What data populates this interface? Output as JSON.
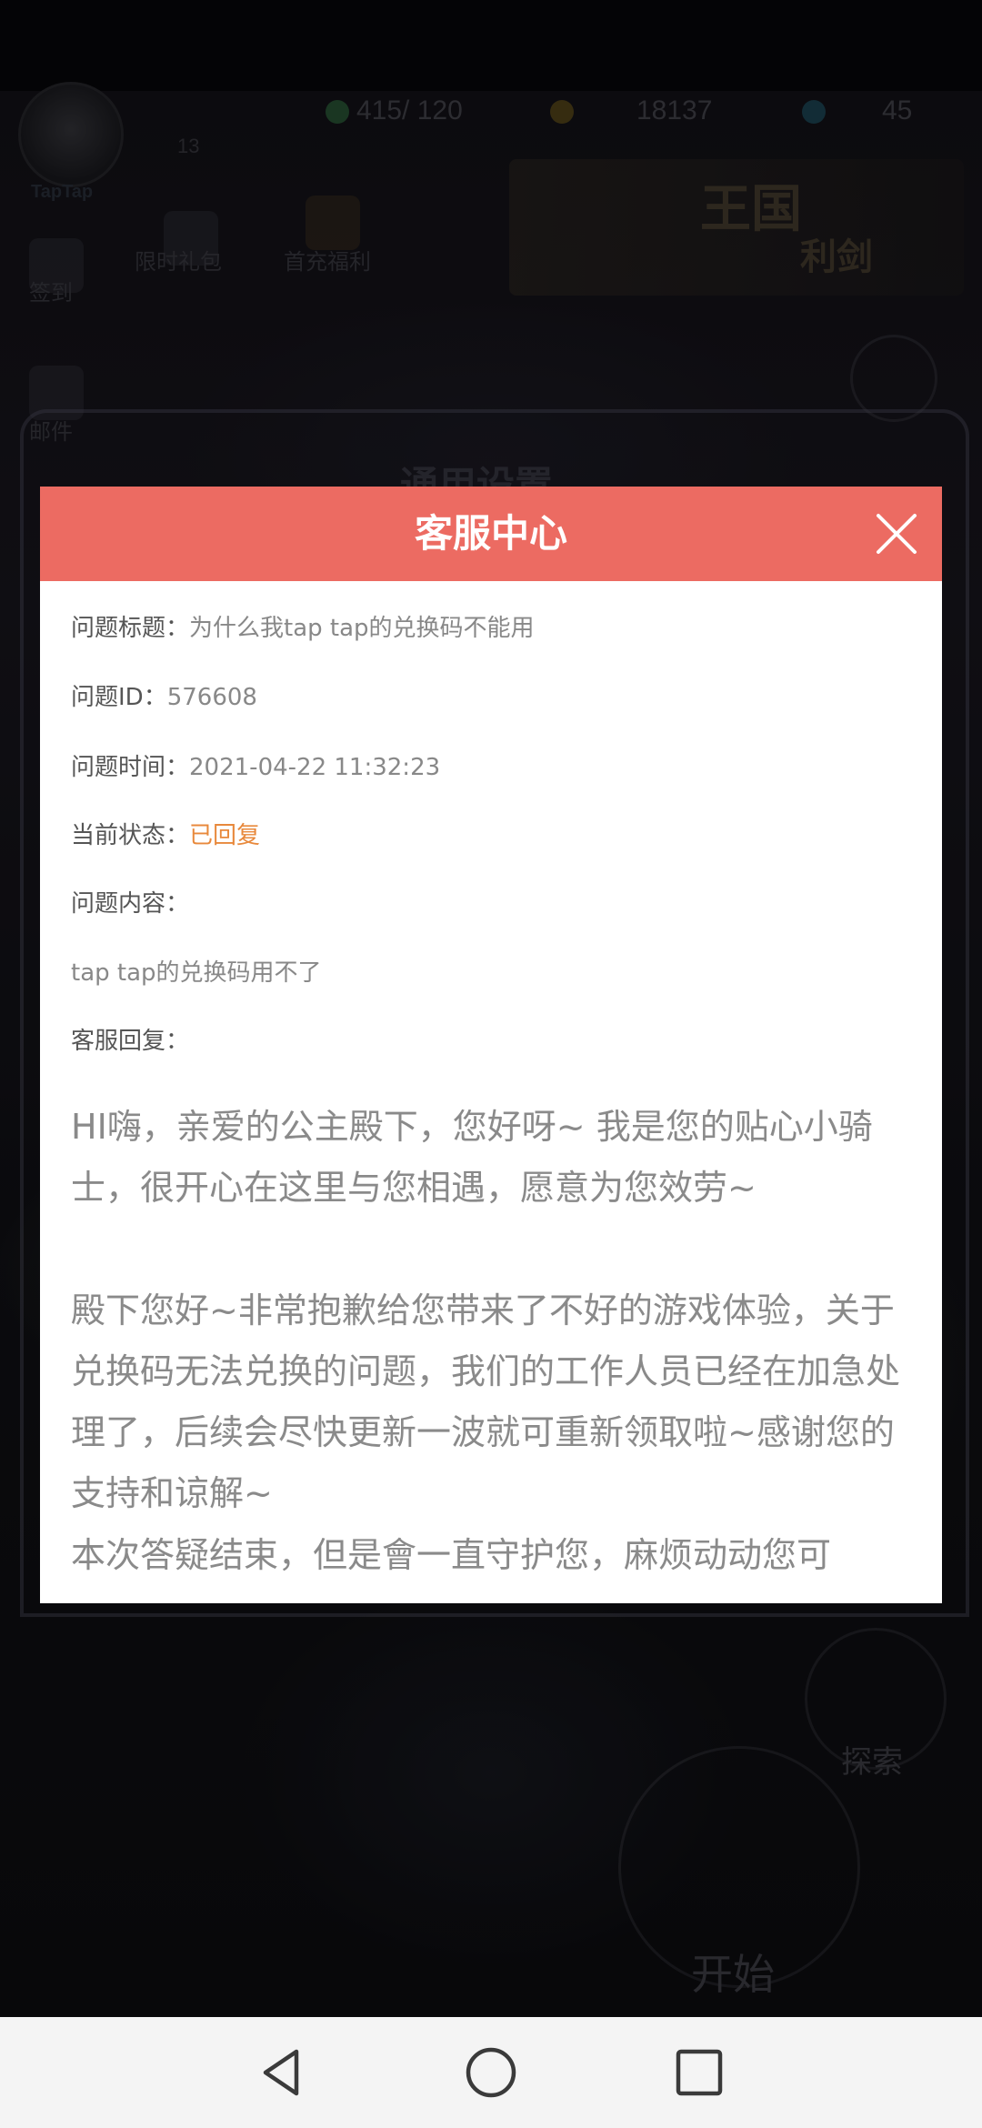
{
  "background": {
    "avatar_tag": "TapTap",
    "level": "13",
    "resources": {
      "energy": "415/ 120",
      "gold": "18137",
      "gems": "45"
    },
    "banner_title": "王国",
    "banner_sub": "利剑",
    "side_labels": {
      "signin": "签到",
      "limited_pack": "限时礼包",
      "first_charge": "首充福利",
      "mail": "邮件",
      "explore": "探索",
      "start": "开始"
    },
    "frame_title": "通用设置"
  },
  "dialog": {
    "title": "客服中心",
    "close_icon": "close-icon",
    "fields": {
      "title_label": "问题标题：",
      "title_value": "为什么我tap tap的兑换码不能用",
      "id_label": "问题ID：",
      "id_value": "576608",
      "time_label": "问题时间：",
      "time_value": "2021-04-22 11:32:23",
      "status_label": "当前状态：",
      "status_value": "已回复",
      "content_label": "问题内容：",
      "content_value": "tap tap的兑换码用不了",
      "reply_label": "客服回复："
    },
    "reply": {
      "p1": "HI嗨，亲爱的公主殿下，您好呀~ 我是您的贴心小骑士，很开心在这里与您相遇，愿意为您效劳~",
      "p2": "殿下您好~非常抱歉给您带来了不好的游戏体验，关于兑换码无法兑换的问题，我们的工作人员已经在加急处理了，后续会尽快更新一波就可重新领取啦~感谢您的支持和谅解~",
      "p3_partial": "本次答疑结束，但是會一直守护您，麻烦动动您可"
    },
    "colors": {
      "header": "#ec6b62",
      "status": "#e8893c"
    }
  },
  "navbar": {
    "icons": [
      "back-icon",
      "home-icon",
      "recents-icon"
    ]
  }
}
